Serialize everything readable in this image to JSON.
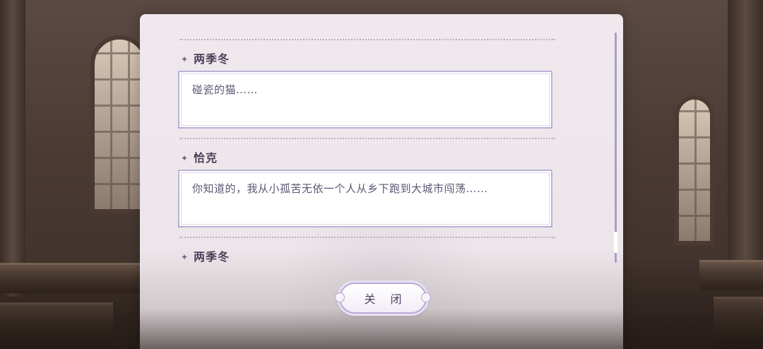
{
  "dialog_log": {
    "entries": [
      {
        "speaker": "两季冬",
        "text": "碰瓷的猫……"
      },
      {
        "speaker": "恰克",
        "text": "你知道的，我从小孤苦无依一个人从乡下跑到大城市闯荡……"
      },
      {
        "speaker": "两季冬",
        "text": ""
      }
    ],
    "close_label": "关 闭"
  },
  "icons": {
    "speaker_marker": "sparkle-star-icon"
  },
  "colors": {
    "panel_bg": "#efe9ed",
    "accent": "#a99ccc",
    "text": "#5e5574"
  }
}
